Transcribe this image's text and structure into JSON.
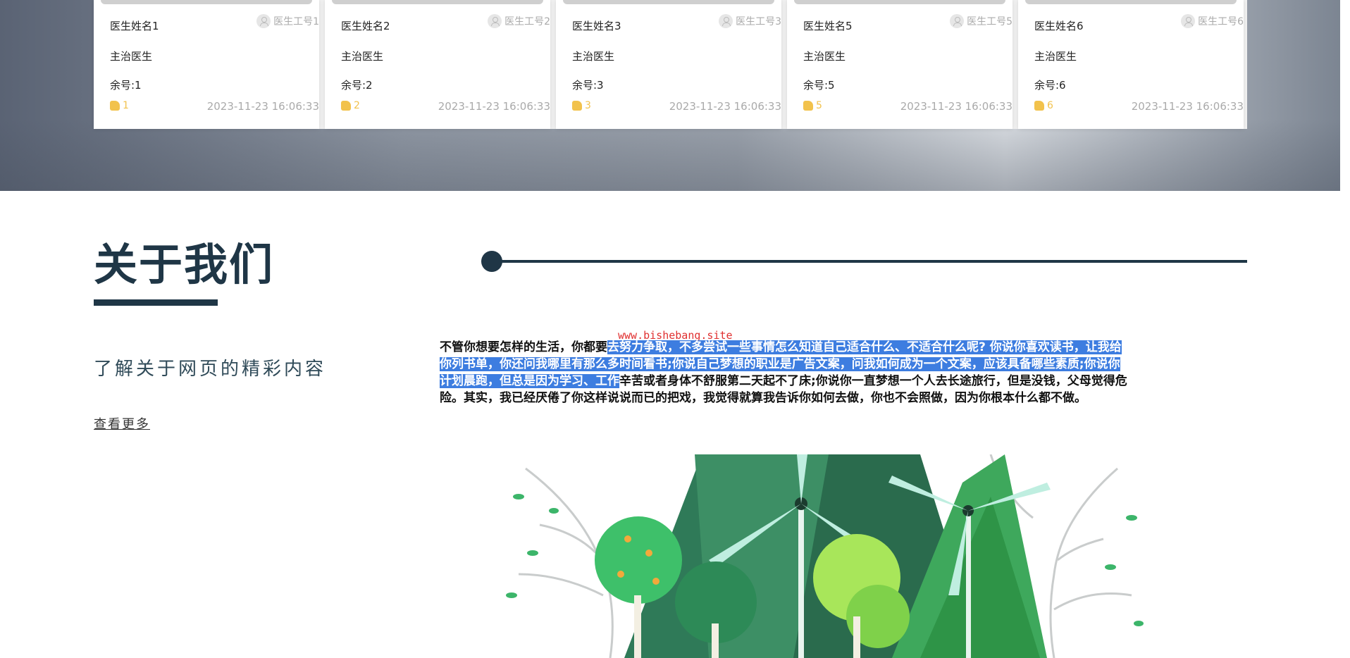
{
  "doctors": [
    {
      "name": "医生姓名1",
      "id": "医生工号1",
      "title": "主治医生",
      "remain": "余号:1",
      "likes": "1",
      "time": "2023-11-23 16:06:33"
    },
    {
      "name": "医生姓名2",
      "id": "医生工号2",
      "title": "主治医生",
      "remain": "余号:2",
      "likes": "2",
      "time": "2023-11-23 16:06:33"
    },
    {
      "name": "医生姓名3",
      "id": "医生工号3",
      "title": "主治医生",
      "remain": "余号:3",
      "likes": "3",
      "time": "2023-11-23 16:06:33"
    },
    {
      "name": "医生姓名5",
      "id": "医生工号5",
      "title": "主治医生",
      "remain": "余号:5",
      "likes": "5",
      "time": "2023-11-23 16:06:33"
    },
    {
      "name": "医生姓名6",
      "id": "医生工号6",
      "title": "主治医生",
      "remain": "余号:6",
      "likes": "6",
      "time": "2023-11-23 16:06:33"
    }
  ],
  "about": {
    "title": "关于我们",
    "subtitle": "了解关于网页的精彩内容",
    "more_label": "查看更多",
    "watermark": "www.bishebang.site",
    "text_before": "不管你想要怎样的生活，你都要",
    "text_highlight": "去努力争取，不多尝试一些事情怎么知道自己适合什么、不适合什么呢? 你说你喜欢读书，让我给你列书单，你还问我哪里有那么多时间看书;你说自己梦想的职业是广告文案，问我如何成为一个文案，应该具备哪些素质;你说你计划晨跑，但总是因为学习、工作",
    "text_after": "辛苦或者身体不舒服第二天起不了床;你说你一直梦想一个人去长途旅行，但是没钱，父母觉得危险。其实，我已经厌倦了你这样说说而已的把戏，我觉得就算我告诉你如何去做，你也不会照做，因为你根本什么都不做。"
  },
  "colors": {
    "accent": "#1f3646",
    "highlight": "#3d7de0",
    "likes": "#f2c24c"
  },
  "icons": {
    "doctor_id": "user-icon",
    "likes": "thumb-up-icon"
  }
}
